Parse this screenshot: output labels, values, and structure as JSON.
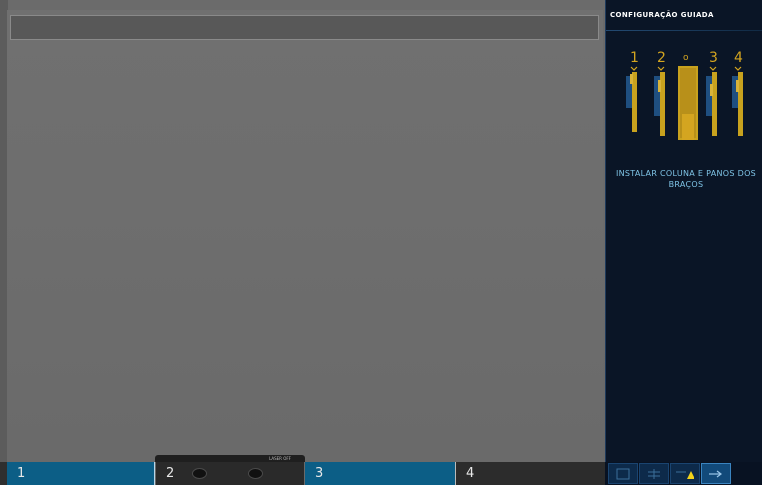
{
  "panel": {
    "title": "CONFIGURAÇÃO GUIADA",
    "instruction": "INSTALAR COLUNA E PANOS DOS BRAÇOS",
    "arm_labels": [
      "1",
      "2",
      "o",
      "3",
      "4"
    ]
  },
  "arms": [
    {
      "label": "1"
    },
    {
      "label": "2",
      "tag": "LASER OFF"
    },
    {
      "label": "3"
    },
    {
      "label": "4"
    }
  ],
  "toolbar": {
    "icons": [
      "panel-icon",
      "adjust-icon",
      "warning-icon",
      "arrow-icon"
    ]
  },
  "colors": {
    "panel_bg": "#0a1526",
    "accent_blue": "#0c5e86",
    "arm_gold": "#c8a21e",
    "warning_yellow": "#f2d21a"
  }
}
